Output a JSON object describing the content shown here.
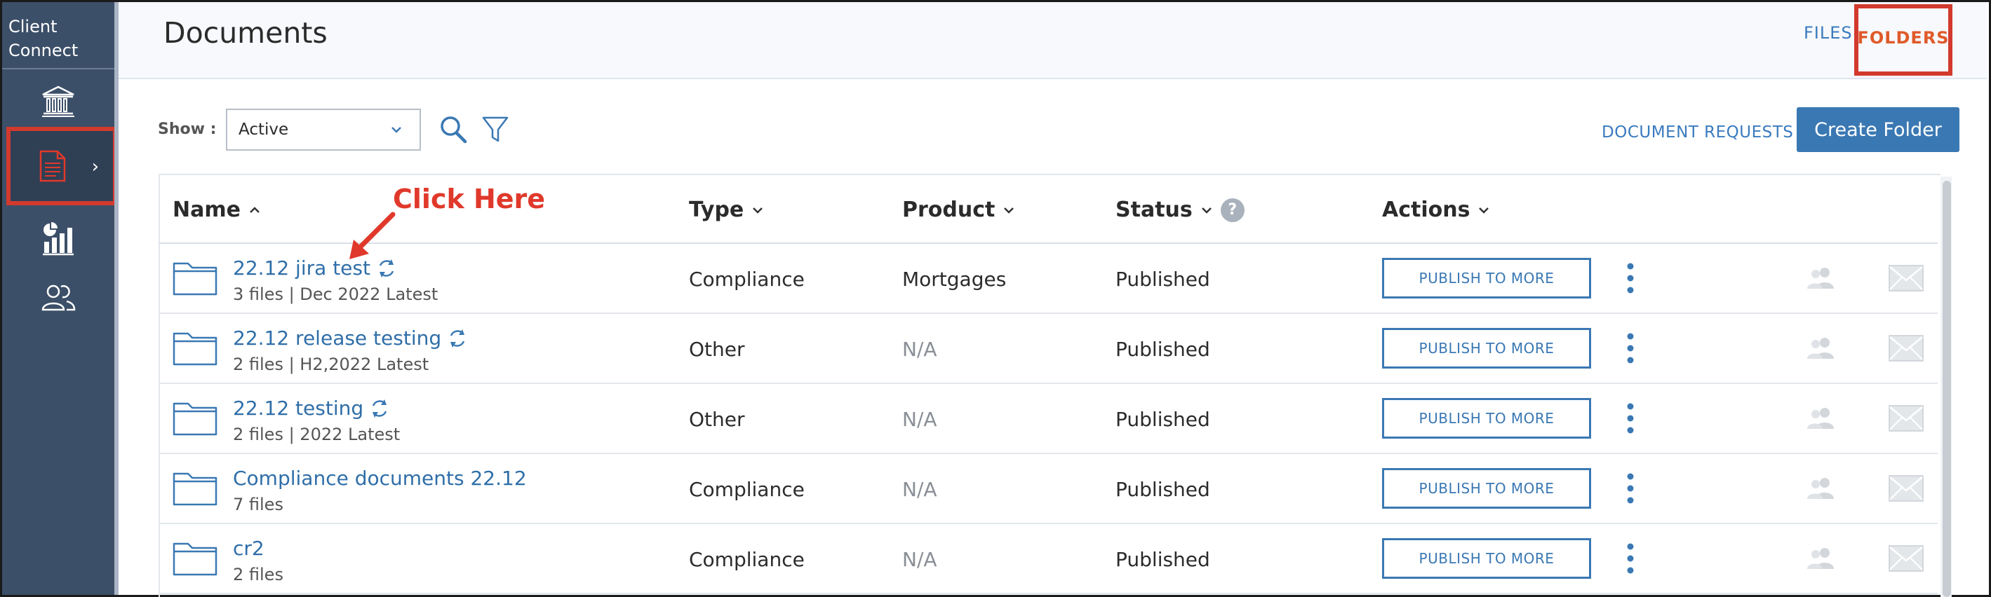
{
  "sidebar": {
    "brand": "Client Connect",
    "items": [
      {
        "id": "bank",
        "icon": "bank-icon"
      },
      {
        "id": "documents",
        "icon": "document-icon",
        "active": true
      },
      {
        "id": "reports",
        "icon": "chart-icon"
      },
      {
        "id": "users",
        "icon": "users-icon"
      }
    ],
    "active_color": "#d23a2e"
  },
  "header": {
    "title": "Documents",
    "tabs": [
      {
        "label": "FILES",
        "active": false
      },
      {
        "label": "FOLDERS",
        "active": true
      }
    ]
  },
  "toolbar": {
    "show_label": "Show :",
    "show_value": "Active",
    "document_requests": "DOCUMENT REQUESTS",
    "create_folder": "Create Folder"
  },
  "table": {
    "columns": [
      {
        "label": "Name",
        "sort": "up"
      },
      {
        "label": "Type",
        "sort": "down"
      },
      {
        "label": "Product",
        "sort": "down"
      },
      {
        "label": "Status",
        "sort": "down",
        "help": "?"
      },
      {
        "label": "Actions",
        "sort": "down"
      }
    ],
    "publish_label": "PUBLISH TO MORE",
    "rows": [
      {
        "name": "22.12 jira test",
        "sync": true,
        "sub": "3 files | Dec 2022 Latest",
        "type": "Compliance",
        "product": "Mortgages",
        "product_muted": false,
        "status": "Published"
      },
      {
        "name": "22.12 release testing",
        "sync": true,
        "sub": "2 files | H2,2022 Latest",
        "type": "Other",
        "product": "N/A",
        "product_muted": true,
        "status": "Published"
      },
      {
        "name": "22.12 testing",
        "sync": true,
        "sub": "2 files | 2022 Latest",
        "type": "Other",
        "product": "N/A",
        "product_muted": true,
        "status": "Published"
      },
      {
        "name": "Compliance documents 22.12",
        "sync": false,
        "sub": "7 files",
        "type": "Compliance",
        "product": "N/A",
        "product_muted": true,
        "status": "Published"
      },
      {
        "name": "cr2",
        "sync": false,
        "sub": "2 files",
        "type": "Compliance",
        "product": "N/A",
        "product_muted": true,
        "status": "Published"
      }
    ]
  },
  "annotation": {
    "text": "Click Here",
    "color": "#e0392b"
  },
  "colors": {
    "sidebar_bg": "#3c4f68",
    "link_blue": "#2f6ea8",
    "primary_button": "#3a78b3",
    "folders_tab": "#e05a2a"
  }
}
